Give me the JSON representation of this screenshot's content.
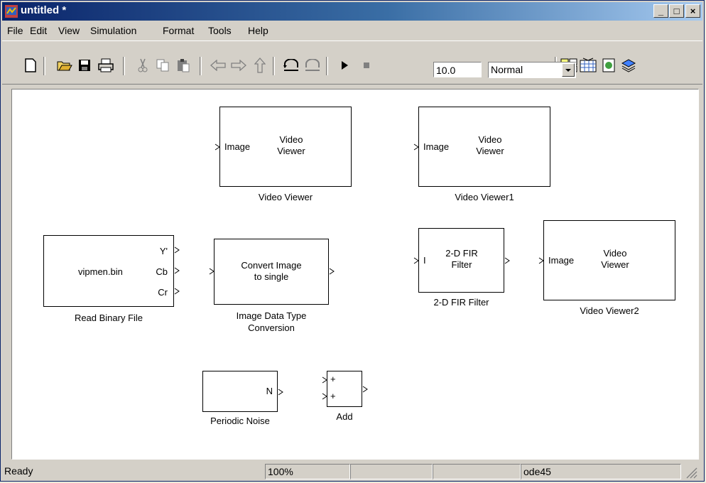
{
  "window": {
    "title": "untitled *"
  },
  "menu": [
    "File",
    "Edit",
    "View",
    "Simulation",
    "Format",
    "Tools",
    "Help"
  ],
  "toolbar": {
    "icons": [
      "new-model-icon",
      "open-icon",
      "save-icon",
      "print-icon",
      "cut-icon",
      "copy-icon",
      "paste-icon",
      "back-icon",
      "forward-icon",
      "up-icon",
      "undo-icon",
      "redo-icon",
      "start-icon",
      "stop-icon",
      "library-browser-icon",
      "model-explorer-icon",
      "debugger-icon",
      "update-diagram-icon"
    ],
    "stop_time": "10.0",
    "sim_mode": "Normal"
  },
  "blocks": {
    "vv": {
      "line1": "Video",
      "line2": "Viewer",
      "port": "Image",
      "label": "Video Viewer"
    },
    "vv1": {
      "line1": "Video",
      "line2": "Viewer",
      "port": "Image",
      "label": "Video Viewer1"
    },
    "vv2": {
      "line1": "Video",
      "line2": "Viewer",
      "port": "Image",
      "label": "Video Viewer2"
    },
    "rbf": {
      "text": "vipmen.bin",
      "p1": "Y'",
      "p2": "Cb",
      "p3": "Cr",
      "label": "Read Binary File"
    },
    "idtc": {
      "line1": "Convert Image",
      "line2": "to single",
      "label1": "Image Data Type",
      "label2": "Conversion"
    },
    "fir": {
      "line1": "2-D FIR",
      "line2": "Filter",
      "port": "I",
      "label": "2-D FIR Filter"
    },
    "pn": {
      "port": "N",
      "label": "Periodic Noise"
    },
    "add": {
      "p1": "+",
      "p2": "+",
      "label": "Add"
    }
  },
  "status": {
    "ready": "Ready",
    "zoom": "100%",
    "empty1": "",
    "empty2": "",
    "solver": "ode45"
  },
  "colors": {
    "title_start": "#0a246a",
    "title_end": "#a6caf0",
    "chrome": "#d4d0c8"
  }
}
